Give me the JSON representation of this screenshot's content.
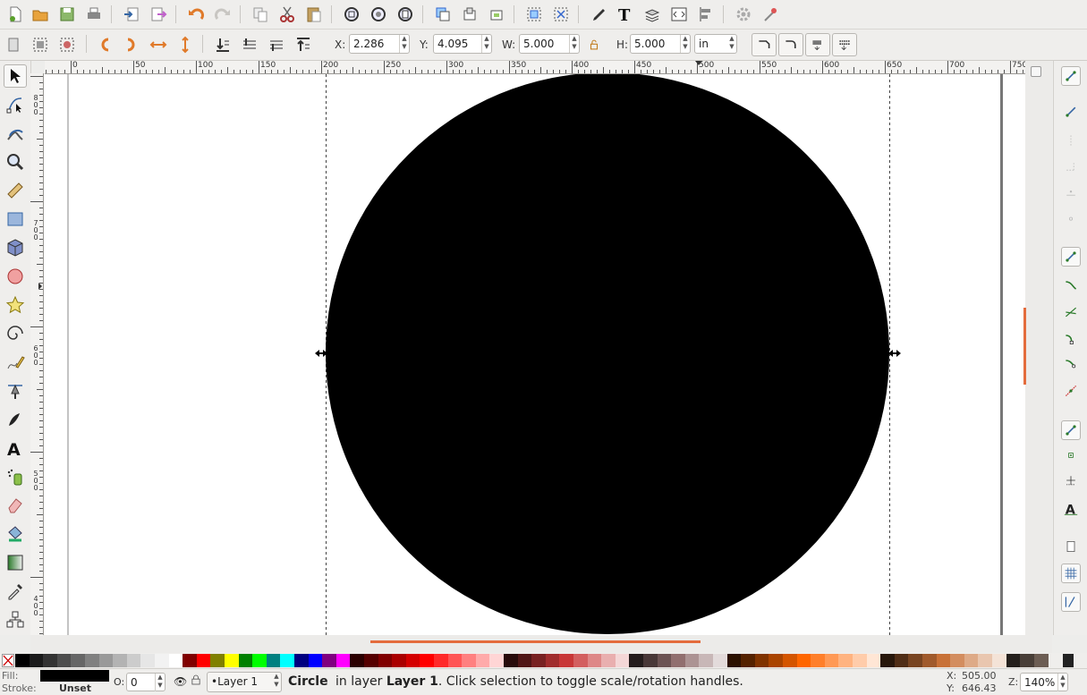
{
  "app": {
    "name": "Inkscape"
  },
  "toolbar": {
    "x_label": "X:",
    "x_value": "2.286",
    "y_label": "Y:",
    "y_value": "4.095",
    "w_label": "W:",
    "w_value": "5.000",
    "h_label": "H:",
    "h_value": "5.000",
    "unit": "in"
  },
  "rulers": {
    "h_labels": [
      "0",
      "50",
      "100",
      "150",
      "200",
      "250",
      "300",
      "350",
      "400",
      "450",
      "500",
      "550",
      "600",
      "650",
      "700",
      "750"
    ],
    "v_labels": [
      "800",
      "700",
      "600",
      "500",
      "400"
    ]
  },
  "style_indicator": {
    "fill_label": "Fill:",
    "stroke_label": "Stroke:",
    "stroke_value": "Unset",
    "fill_color": "#000000",
    "opacity_label": "O:",
    "opacity_value": "0"
  },
  "layer": {
    "current": "•Layer 1"
  },
  "status": {
    "object": "Circle",
    "middle": "in layer",
    "layer": "Layer 1",
    "message": ". Click selection to toggle scale/rotation handles."
  },
  "cursor": {
    "x_label": "X:",
    "x": "505.00",
    "y_label": "Y:",
    "y": "646.43",
    "zoom_label": "Z:",
    "zoom": "140%"
  },
  "colors": {
    "accent": "#e46c3d",
    "palette": [
      "#000000",
      "#1a1a1a",
      "#333333",
      "#4d4d4d",
      "#666666",
      "#808080",
      "#999999",
      "#b3b3b3",
      "#cccccc",
      "#e6e6e6",
      "#f2f2f2",
      "#ffffff",
      "#800000",
      "#ff0000",
      "#808000",
      "#ffff00",
      "#008000",
      "#00ff00",
      "#008080",
      "#00ffff",
      "#000080",
      "#0000ff",
      "#800080",
      "#ff00ff",
      "#2b0000",
      "#550000",
      "#800000",
      "#aa0000",
      "#d40000",
      "#ff0000",
      "#ff2a2a",
      "#ff5555",
      "#ff8080",
      "#ffaaaa",
      "#ffd5d5",
      "#280b0b",
      "#501616",
      "#782121",
      "#a02c2c",
      "#c83737",
      "#d35f5f",
      "#de8787",
      "#e9afaf",
      "#f4d7d7",
      "#241c1c",
      "#483737",
      "#6c5353",
      "#916f6f",
      "#ac9393",
      "#c8b7b7",
      "#e3dbdb",
      "#2b1100",
      "#552200",
      "#803300",
      "#aa4400",
      "#d45500",
      "#ff6600",
      "#ff7f2a",
      "#ff9955",
      "#ffb380",
      "#ffccaa",
      "#ffe6d5",
      "#28170b",
      "#502d16",
      "#784421",
      "#a05a2c",
      "#c87137",
      "#d38d5f",
      "#deaa87",
      "#e9c6af",
      "#f4e3d7",
      "#241f1c",
      "#483e37",
      "#6c5d53"
    ]
  }
}
